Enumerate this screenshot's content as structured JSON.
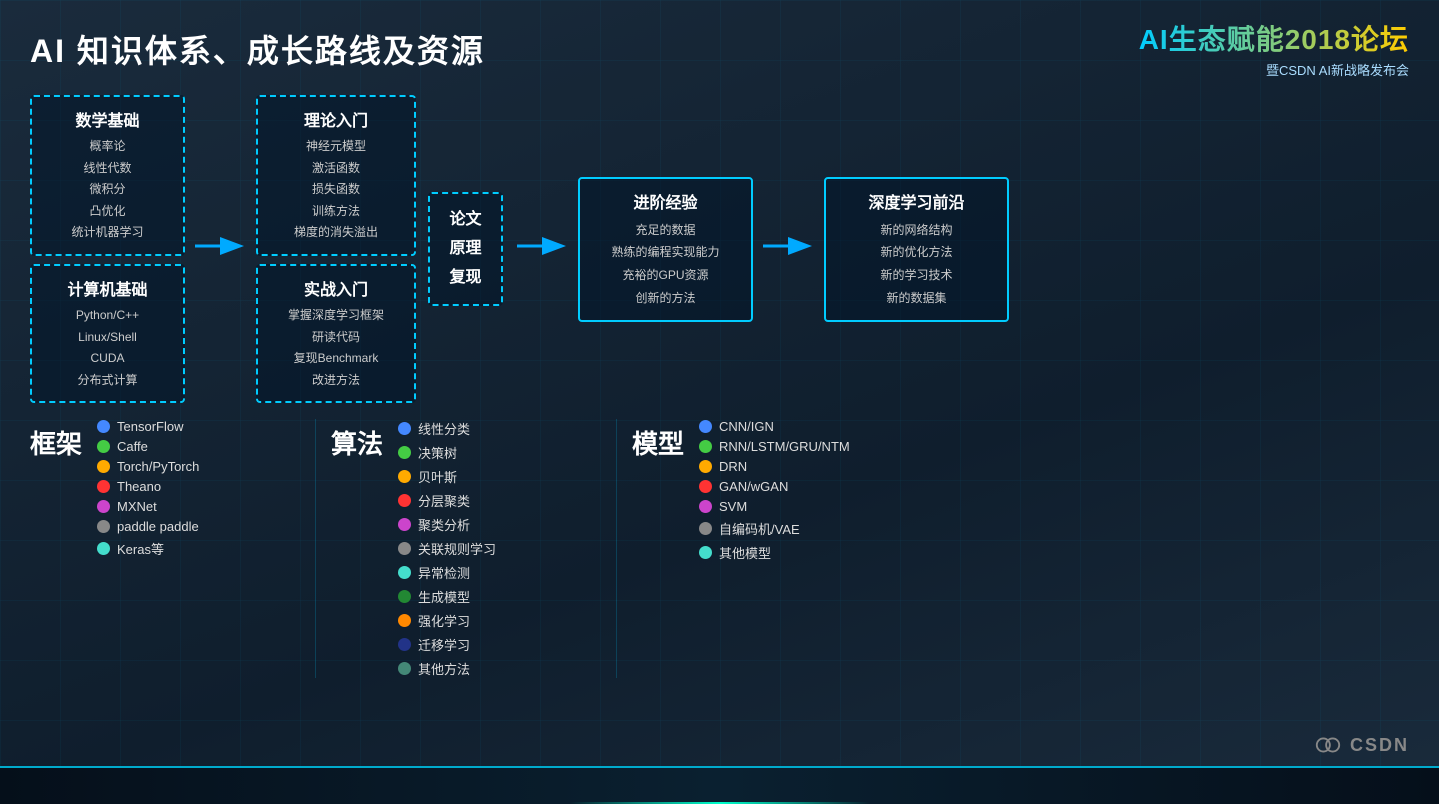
{
  "header": {
    "title": "AI 知识体系、成长路线及资源",
    "logo_title": "AI生态赋能2018论坛",
    "logo_subtitle": "暨CSDN AI新战略发布会"
  },
  "flow": {
    "box1_title": "数学基础",
    "box1_items": [
      "概率论",
      "线性代数",
      "微积分",
      "凸优化",
      "统计机器学习"
    ],
    "box2_title": "计算机基础",
    "box2_items": [
      "Python/C++",
      "Linux/Shell",
      "CUDA",
      "分布式计算"
    ],
    "box3_title": "理论入门",
    "box3_items": [
      "神经元模型",
      "激活函数",
      "损失函数",
      "训练方法",
      "梯度的消失溢出"
    ],
    "box4_title": "实战入门",
    "box4_items": [
      "掌握深度学习框架",
      "研读代码",
      "复现Benchmark",
      "改进方法"
    ],
    "box5_title": "论文",
    "box5_items": [
      "原理",
      "复现"
    ],
    "box6_title": "进阶经验",
    "box6_items": [
      "充足的数据",
      "熟练的编程实现能力",
      "充裕的GPU资源",
      "创新的方法"
    ],
    "box7_title": "深度学习前沿",
    "box7_items": [
      "新的网络结构",
      "新的优化方法",
      "新的学习技术",
      "新的数据集"
    ]
  },
  "frameworks": {
    "label": "框架",
    "items": [
      {
        "color": "#4488ff",
        "name": "TensorFlow"
      },
      {
        "color": "#44cc44",
        "name": "Caffe"
      },
      {
        "color": "#ffaa00",
        "name": "Torch/PyTorch"
      },
      {
        "color": "#ff3333",
        "name": "Theano"
      },
      {
        "color": "#cc44cc",
        "name": "MXNet"
      },
      {
        "color": "#888888",
        "name": "paddle paddle"
      },
      {
        "color": "#44ddcc",
        "name": "Keras等"
      }
    ]
  },
  "algorithms": {
    "label": "算法",
    "items": [
      {
        "color": "#4488ff",
        "name": "线性分类"
      },
      {
        "color": "#44cc44",
        "name": "决策树"
      },
      {
        "color": "#ffaa00",
        "name": "贝叶斯"
      },
      {
        "color": "#ff3333",
        "name": "分层聚类"
      },
      {
        "color": "#cc44cc",
        "name": "聚类分析"
      },
      {
        "color": "#888888",
        "name": "关联规则学习"
      },
      {
        "color": "#44ddcc",
        "name": "异常检测"
      },
      {
        "color": "#228833",
        "name": "生成模型"
      },
      {
        "color": "#ff8800",
        "name": "强化学习"
      },
      {
        "color": "#223388",
        "name": "迁移学习"
      },
      {
        "color": "#448877",
        "name": "其他方法"
      }
    ]
  },
  "models": {
    "label": "模型",
    "items": [
      {
        "color": "#4488ff",
        "name": "CNN/IGN"
      },
      {
        "color": "#44cc44",
        "name": "RNN/LSTM/GRU/NTM"
      },
      {
        "color": "#ffaa00",
        "name": "DRN"
      },
      {
        "color": "#ff3333",
        "name": "GAN/wGAN"
      },
      {
        "color": "#cc44cc",
        "name": "SVM"
      },
      {
        "color": "#888888",
        "name": "自编码机/VAE"
      },
      {
        "color": "#44ddcc",
        "name": "其他模型"
      }
    ]
  }
}
